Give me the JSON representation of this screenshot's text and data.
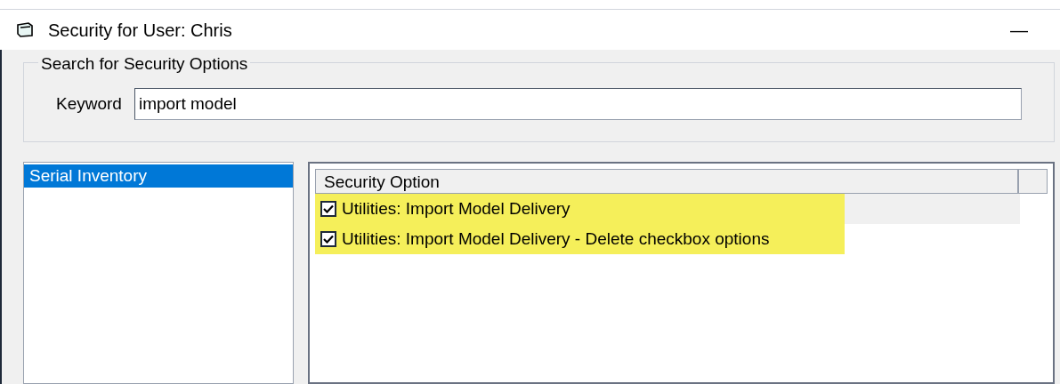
{
  "window": {
    "title": "Security for User: Chris",
    "minimize": "—"
  },
  "search": {
    "legend": "Search for Security Options",
    "label": "Keyword",
    "value": "import model"
  },
  "categories": [
    {
      "label": "Serial Inventory",
      "selected": true
    }
  ],
  "table": {
    "columns": [
      "Security Option"
    ],
    "rows": [
      {
        "label": "Utilities: Import Model Delivery",
        "checked": true,
        "selected": true,
        "highlighted": true
      },
      {
        "label": "Utilities: Import Model Delivery - Delete checkbox options",
        "checked": true,
        "selected": false,
        "highlighted": true
      }
    ]
  }
}
